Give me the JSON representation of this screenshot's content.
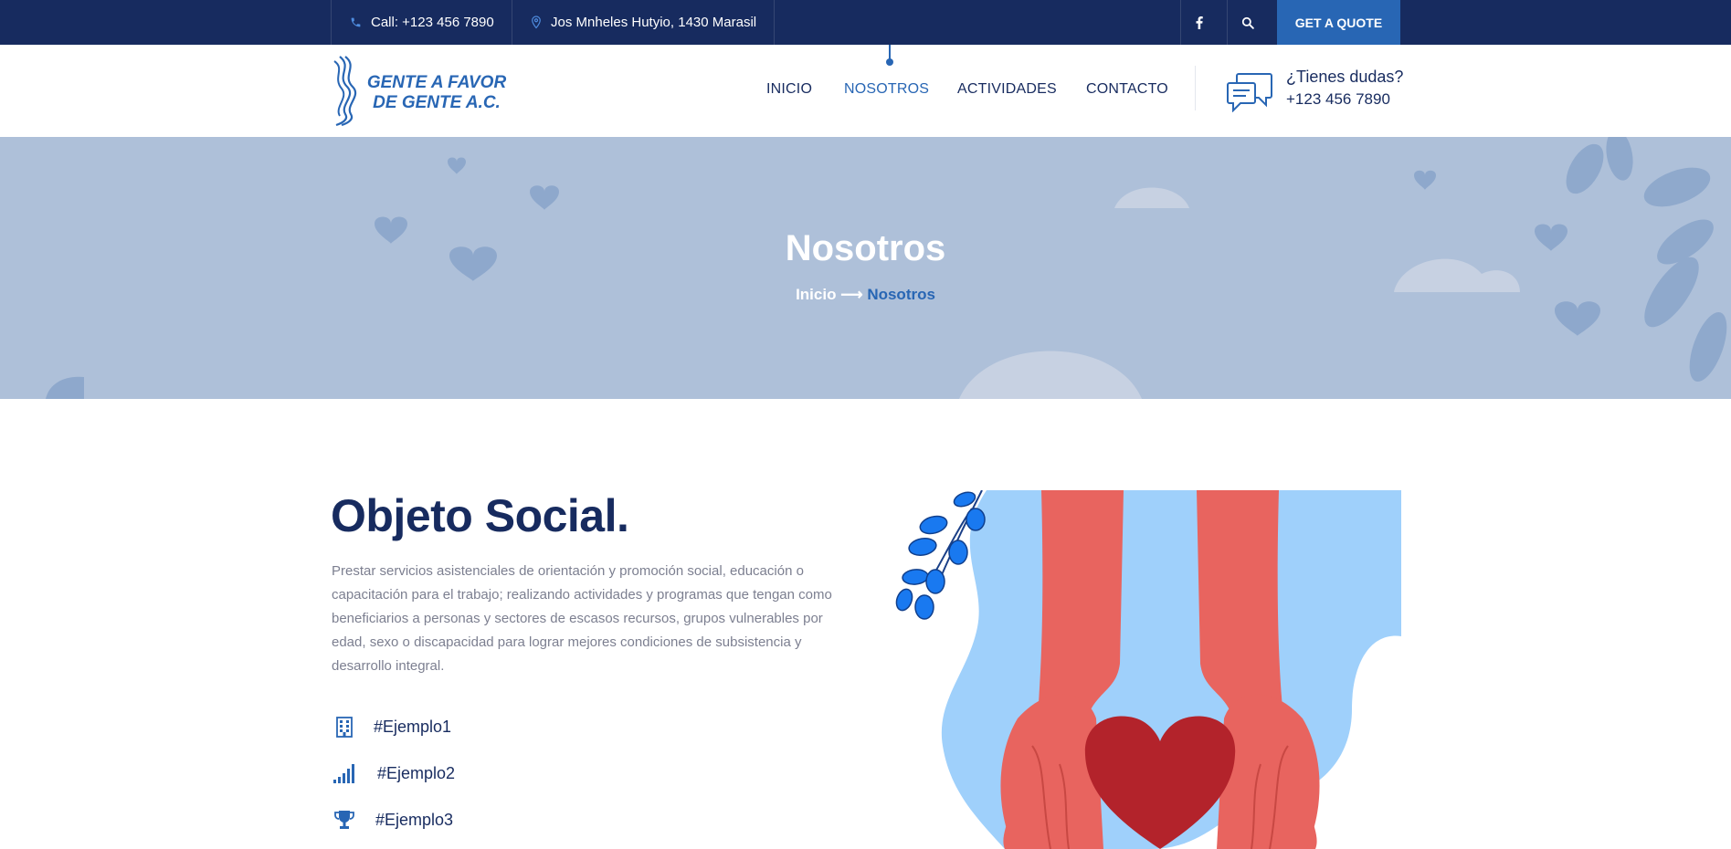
{
  "topbar": {
    "call": "Call: +123 456 7890",
    "address": "Jos Mnheles Hutyio, 1430 Marasil",
    "quote_label": "GET A QUOTE",
    "icons": [
      "phone-icon",
      "location-pin-icon",
      "facebook-icon",
      "search-icon"
    ]
  },
  "header": {
    "logo_line1": "GENTE A FAVOR",
    "logo_line2": "DE GENTE A.C.",
    "nav": [
      "INICIO",
      "NOSOTROS",
      "ACTIVIDADES",
      "CONTACTO"
    ],
    "active_nav": "NOSOTROS",
    "help_question": "¿Tienes dudas?",
    "help_phone": "+123 456 7890"
  },
  "hero": {
    "title": "Nosotros",
    "breadcrumb_home": "Inicio",
    "breadcrumb_sep": "⟶",
    "breadcrumb_current": "Nosotros"
  },
  "section": {
    "title": "Objeto Social.",
    "description": "Prestar servicios asistenciales de orientación y promoción social, educación o capacitación para el trabajo; realizando actividades y programas que tengan como beneficiarios a personas y sectores de escasos recursos, grupos vulnerables por edad, sexo o discapacidad para lograr mejores condiciones de subsistencia y desarrollo integral.",
    "features": [
      {
        "label": "#Ejemplo1",
        "icon": "building-icon"
      },
      {
        "label": "#Ejemplo2",
        "icon": "signal-bars-icon"
      },
      {
        "label": "#Ejemplo3",
        "icon": "trophy-icon"
      }
    ]
  },
  "colors": {
    "navy": "#172b5f",
    "accent": "#2866b4",
    "hero_bg": "#aec0d9",
    "text_muted": "#7c7f90"
  }
}
